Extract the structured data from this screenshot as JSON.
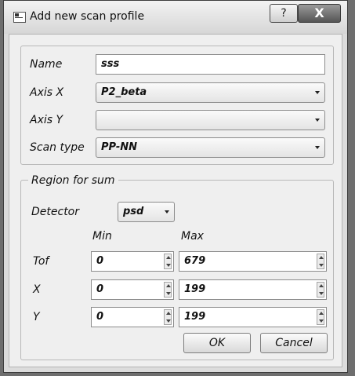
{
  "window": {
    "title": "Add new scan profile",
    "help_glyph": "?",
    "close_glyph": "X"
  },
  "profile": {
    "name_label": "Name",
    "name_value": "sss",
    "axis_x_label": "Axis X",
    "axis_x_value": "P2_beta",
    "axis_y_label": "Axis Y",
    "axis_y_value": "",
    "scan_type_label": "Scan type",
    "scan_type_value": "PP-NN"
  },
  "region": {
    "title": "Region for sum",
    "detector_label": "Detector",
    "detector_value": "psd",
    "min_header": "Min",
    "max_header": "Max",
    "rows": [
      {
        "label": "Tof",
        "min": "0",
        "max": "679"
      },
      {
        "label": "X",
        "min": "0",
        "max": "199"
      },
      {
        "label": "Y",
        "min": "0",
        "max": "199"
      }
    ]
  },
  "buttons": {
    "ok": "OK",
    "cancel": "Cancel"
  }
}
